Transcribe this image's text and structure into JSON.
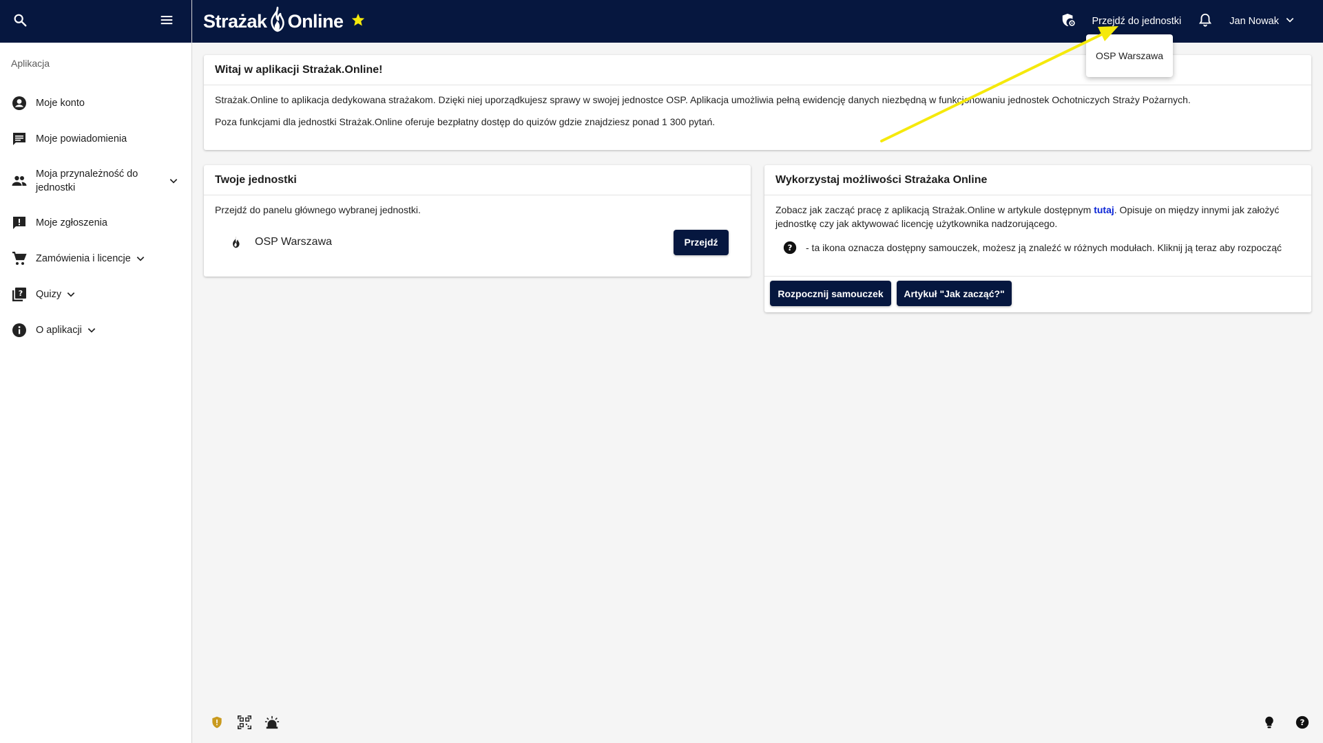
{
  "sidebar": {
    "section_label": "Aplikacja",
    "items": [
      {
        "label": "Moje konto",
        "icon": "account-circle-icon"
      },
      {
        "label": "Moje powiadomienia",
        "icon": "message-icon"
      },
      {
        "label": "Moja przynależność do jednostki",
        "icon": "people-icon"
      },
      {
        "label": "Moje zgłoszenia",
        "icon": "feedback-icon"
      },
      {
        "label": "Zamówienia i licencje",
        "icon": "cart-icon"
      },
      {
        "label": "Quizy",
        "icon": "quiz-icon"
      },
      {
        "label": "O aplikacji",
        "icon": "info-icon"
      }
    ]
  },
  "header": {
    "brand_left": "Strażak",
    "brand_right": "Online",
    "go_to_unit": "Przejdź do jednostki",
    "user_name": "Jan Nowak"
  },
  "dropdown": {
    "item": "OSP Warszawa"
  },
  "welcome": {
    "title": "Witaj w aplikacji Strażak.Online!",
    "p1": "Strażak.Online to aplikacja dedykowana strażakom. Dzięki niej uporządkujesz sprawy w swojej jednostce OSP. Aplikacja umożliwia pełną ewidencję danych niezbędną w funkcjonowaniu jednostek Ochotniczych Straży Pożarnych.",
    "p2": "Poza funkcjami dla jednostki Strażak.Online oferuje bezpłatny dostęp do quizów gdzie znajdziesz ponad 1 300 pytań."
  },
  "units": {
    "title": "Twoje jednostki",
    "subtitle": "Przejdź do panelu głównego wybranej jednostki.",
    "unit_name": "OSP Warszawa",
    "go_button": "Przejdź"
  },
  "features": {
    "title": "Wykorzystaj możliwości Strażaka Online",
    "text_before_link": "Zobacz jak zacząć pracę z aplikacją Strażak.Online w artykule dostępnym ",
    "link": "tutaj",
    "text_after_link": ". Opisuje on między innymi jak założyć jednostkę czy jak aktywować licencję użytkownika nadzorującego.",
    "tip": "- ta ikona oznacza dostępny samouczek, możesz ją znaleźć w różnych modułach. Kliknij ją teraz aby rozpocząć",
    "btn_tutorial": "Rozpocznij samouczek",
    "btn_article": "Artykuł \"Jak zacząć?\""
  },
  "colors": {
    "navy": "#06173f",
    "accent_yellow": "#f5e90c",
    "link_blue": "#0b25d6",
    "shield_gold": "#c99a1e"
  }
}
